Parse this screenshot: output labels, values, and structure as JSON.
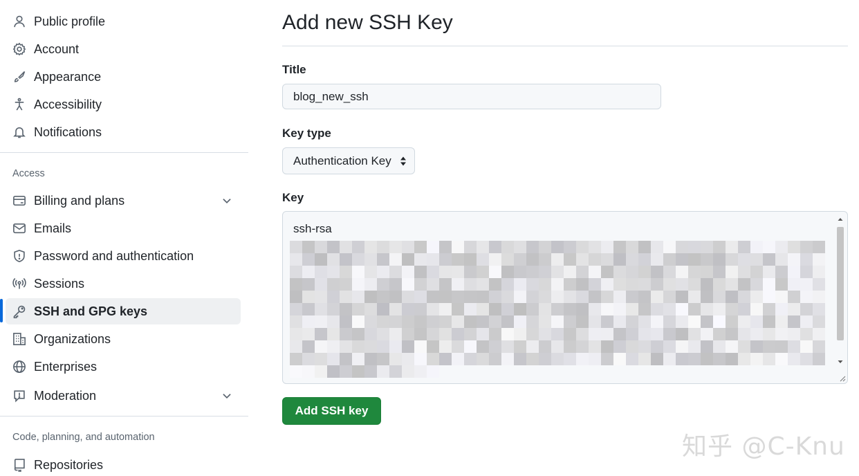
{
  "sidebar": {
    "items_top": [
      {
        "label": "Public profile",
        "icon": "person-icon"
      },
      {
        "label": "Account",
        "icon": "gear-icon"
      },
      {
        "label": "Appearance",
        "icon": "paintbrush-icon"
      },
      {
        "label": "Accessibility",
        "icon": "accessibility-icon"
      },
      {
        "label": "Notifications",
        "icon": "bell-icon"
      }
    ],
    "access_heading": "Access",
    "items_access": [
      {
        "label": "Billing and plans",
        "icon": "credit-card-icon",
        "expandable": true
      },
      {
        "label": "Emails",
        "icon": "mail-icon"
      },
      {
        "label": "Password and authentication",
        "icon": "shield-icon"
      },
      {
        "label": "Sessions",
        "icon": "broadcast-icon"
      },
      {
        "label": "SSH and GPG keys",
        "icon": "key-icon",
        "active": true
      },
      {
        "label": "Organizations",
        "icon": "organization-icon"
      },
      {
        "label": "Enterprises",
        "icon": "globe-icon"
      },
      {
        "label": "Moderation",
        "icon": "report-icon",
        "expandable": true
      }
    ],
    "code_heading": "Code, planning, and automation",
    "items_code": [
      {
        "label": "Repositories",
        "icon": "repo-icon"
      }
    ]
  },
  "main": {
    "title": "Add new SSH Key",
    "title_label": "Title",
    "title_value": "blog_new_ssh",
    "key_type_label": "Key type",
    "key_type_value": "Authentication Key",
    "key_label": "Key",
    "key_prefix": "ssh-rsa",
    "submit_label": "Add SSH key"
  },
  "colors": {
    "accent": "#0969da",
    "primary_button": "#1f883d"
  },
  "watermark": "知乎 @C-Knu"
}
